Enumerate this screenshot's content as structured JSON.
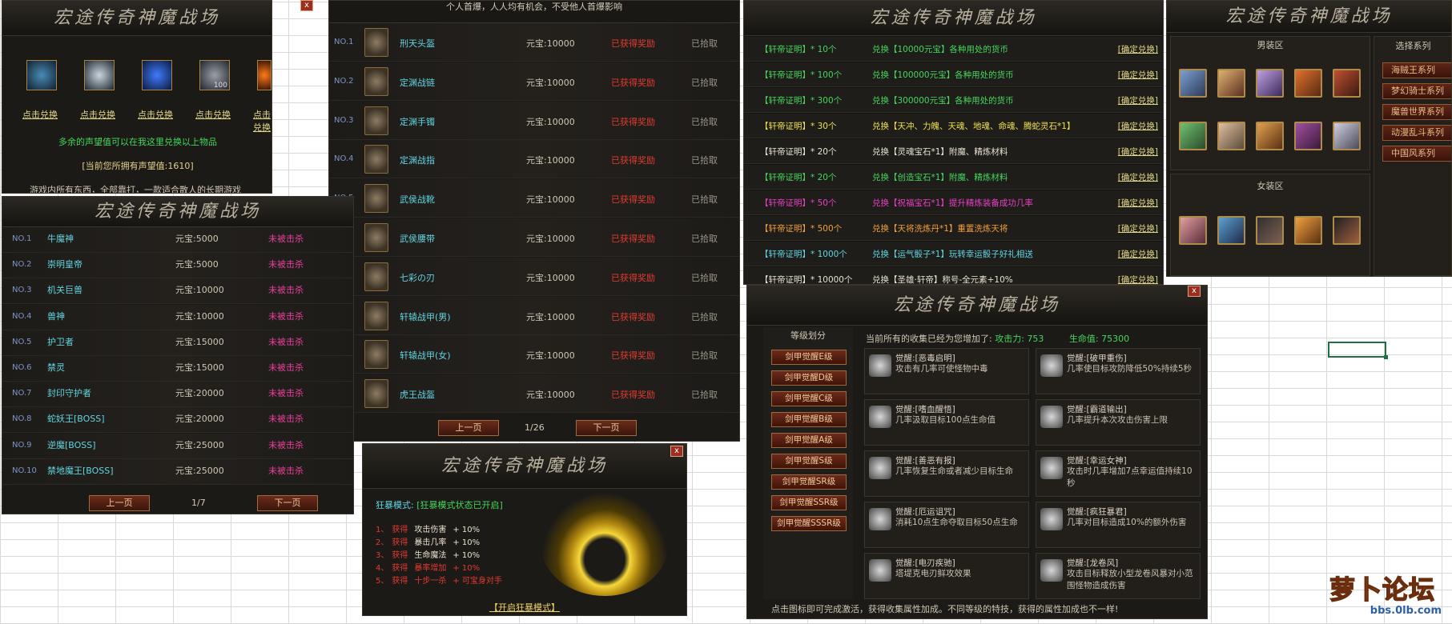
{
  "panel_exchange": {
    "title": "宏途传奇神魔战场",
    "items": [
      "点击兑换",
      "点击兑换",
      "点击兑换",
      "点击兑换",
      "点击兑换"
    ],
    "slot4_count": "100",
    "hint": "多余的声望值可以在我这里兑换以上物品",
    "current": "[当前您所拥有声望值:1610]",
    "footer": "游戏内所有东西，全部靠打，一款适合散人的长期游戏"
  },
  "panel_drops": {
    "header": "个人首爆，人人均有机会，不受他人首爆影响",
    "rows": [
      {
        "no": "NO.1",
        "name": "刑天头盔",
        "reward": "元宝:10000",
        "status": "已获得奖励",
        "action": "已拾取"
      },
      {
        "no": "NO.2",
        "name": "定渊战链",
        "reward": "元宝:10000",
        "status": "已获得奖励",
        "action": "已拾取"
      },
      {
        "no": "NO.3",
        "name": "定渊手镯",
        "reward": "元宝:10000",
        "status": "已获得奖励",
        "action": "已拾取"
      },
      {
        "no": "NO.4",
        "name": "定渊战指",
        "reward": "元宝:10000",
        "status": "已获得奖励",
        "action": "已拾取"
      },
      {
        "no": "NO.5",
        "name": "武侯战靴",
        "reward": "元宝:10000",
        "status": "已获得奖励",
        "action": "已拾取"
      },
      {
        "no": "",
        "name": "武侯腰带",
        "reward": "元宝:10000",
        "status": "已获得奖励",
        "action": "已拾取"
      },
      {
        "no": "",
        "name": "七彩の刃",
        "reward": "元宝:10000",
        "status": "已获得奖励",
        "action": "已拾取"
      },
      {
        "no": "",
        "name": "轩辕战甲(男)",
        "reward": "元宝:10000",
        "status": "已获得奖励",
        "action": "已拾取"
      },
      {
        "no": "",
        "name": "轩辕战甲(女)",
        "reward": "元宝:10000",
        "status": "已获得奖励",
        "action": "已拾取"
      },
      {
        "no": "",
        "name": "虎王战盔",
        "reward": "元宝:10000",
        "status": "已获得奖励",
        "action": "已拾取"
      }
    ],
    "prev": "上一页",
    "page": "1/26",
    "next": "下一页"
  },
  "panel_boss": {
    "title": "宏途传奇神魔战场",
    "rows": [
      {
        "no": "NO.1",
        "name": "牛魔神",
        "reward": "元宝:5000",
        "status": "未被击杀"
      },
      {
        "no": "NO.2",
        "name": "崇明皇帝",
        "reward": "元宝:5000",
        "status": "未被击杀"
      },
      {
        "no": "NO.3",
        "name": "机关巨兽",
        "reward": "元宝:10000",
        "status": "未被击杀"
      },
      {
        "no": "NO.4",
        "name": "兽神",
        "reward": "元宝:10000",
        "status": "未被击杀"
      },
      {
        "no": "NO.5",
        "name": "护卫者",
        "reward": "元宝:15000",
        "status": "未被击杀"
      },
      {
        "no": "NO.6",
        "name": "禁灵",
        "reward": "元宝:15000",
        "status": "未被击杀"
      },
      {
        "no": "NO.7",
        "name": "封印守护者",
        "reward": "元宝:20000",
        "status": "未被击杀"
      },
      {
        "no": "NO.8",
        "name": "蛇妖王[BOSS]",
        "reward": "元宝:20000",
        "status": "未被击杀"
      },
      {
        "no": "NO.9",
        "name": "逆魔[BOSS]",
        "reward": "元宝:25000",
        "status": "未被击杀"
      },
      {
        "no": "NO.10",
        "name": "禁地魔王[BOSS]",
        "reward": "元宝:25000",
        "status": "未被击杀"
      }
    ],
    "prev": "上一页",
    "page": "1/7",
    "next": "下一页"
  },
  "panel_frenzy": {
    "title": "宏途传奇神魔战场",
    "mode_label": "狂暴模式:",
    "mode_status": "[狂暴模式状态已开启]",
    "lines": [
      {
        "idx": "1、",
        "get": "获得",
        "what": "攻击伤害",
        "val": "+ 10%"
      },
      {
        "idx": "2、",
        "get": "获得",
        "what": "暴击几率",
        "val": "+ 10%"
      },
      {
        "idx": "3、",
        "get": "获得",
        "what": "生命魔法",
        "val": "+ 10%"
      },
      {
        "idx": "4、",
        "get": "获得",
        "what": "暴率增加",
        "val": "+ 10%"
      },
      {
        "idx": "5、",
        "get": "获得",
        "what": "十步一杀",
        "val": "+ 可宝身对手"
      }
    ],
    "button": "【开启狂暴模式】"
  },
  "panel_cert": {
    "title": "宏途传奇神魔战场",
    "rows": [
      {
        "c": "green",
        "req": "【轩帝证明】* 10个",
        "desc": "兑换【10000元宝】各种用处的货币",
        "btn": "[确定兑换]"
      },
      {
        "c": "green",
        "req": "【轩帝证明】* 100个",
        "desc": "兑换【100000元宝】各种用处的货币",
        "btn": "[确定兑换]"
      },
      {
        "c": "green",
        "req": "【轩帝证明】* 300个",
        "desc": "兑换【300000元宝】各种用处的货币",
        "btn": "[确定兑换]"
      },
      {
        "c": "yellow",
        "req": "【轩帝证明】* 30个",
        "desc": "兑换【天冲、力魄、天魂、地魂、命魂、腾蛇灵石*1】",
        "btn": "[确定兑换]"
      },
      {
        "c": "white",
        "req": "【轩帝证明】* 20个",
        "desc": "兑换【灵魂宝石*1】附魔、精炼材料",
        "btn": "[确定兑换]"
      },
      {
        "c": "green",
        "req": "【轩帝证明】* 20个",
        "desc": "兑换【创造宝石*1】附魔、精炼材料",
        "btn": "[确定兑换]"
      },
      {
        "c": "pink",
        "req": "【轩帝证明】* 50个",
        "desc": "兑换【祝福宝石*1】提升精炼装备成功几率",
        "btn": "[确定兑换]"
      },
      {
        "c": "orange",
        "req": "【轩帝证明】* 500个",
        "desc": "兑换【天将洗炼丹*1】重置洗炼天将",
        "btn": "[确定兑换]"
      },
      {
        "c": "cyan",
        "req": "【轩帝证明】* 1000个",
        "desc": "兑换【运气骰子*1】玩转幸运骰子好礼相送",
        "btn": "[确定兑换]"
      },
      {
        "c": "white",
        "req": "【轩帝证明】* 10000个",
        "desc": "兑换【圣雄·轩帝】称号-全元素+10%",
        "btn": "[确定兑换]"
      }
    ]
  },
  "panel_fashion": {
    "title": "宏途传奇神魔战场",
    "male": "男装区",
    "female": "女装区",
    "series_label": "选择系列",
    "series": [
      "海贼王系列",
      "梦幻骑士系列",
      "魔兽世界系列",
      "动漫乱斗系列",
      "中国风系列"
    ]
  },
  "panel_awaken": {
    "title": "宏途传奇神魔战场",
    "grade_label": "等级划分",
    "summary_prefix": "当前所有的收集已经为您增加了:",
    "atk_label": "攻击力:",
    "atk": "753",
    "hp_label": "生命值:",
    "hp": "75300",
    "grades": [
      "剑甲觉醒E级",
      "剑甲觉醒D级",
      "剑甲觉醒C级",
      "剑甲觉醒B级",
      "剑甲觉醒A级",
      "剑甲觉醒S级",
      "剑甲觉醒SR级",
      "剑甲觉醒SSR级",
      "剑甲觉醒SSSR级"
    ],
    "skills": [
      {
        "t": "觉醒:[恶毒启明]",
        "d": "攻击有几率可使怪物中毒"
      },
      {
        "t": "觉醒:[破甲重伤]",
        "d": "几率使目标攻防降低50%持续5秒"
      },
      {
        "t": "觉醒:[嗜血醒悟]",
        "d": "几率汲取目标100点生命值"
      },
      {
        "t": "觉醒:[霸道输出]",
        "d": "几率提升本次攻击伤害上限"
      },
      {
        "t": "觉醒:[善恶有报]",
        "d": "几率恢复生命或者减少目标生命"
      },
      {
        "t": "觉醒:[幸运女神]",
        "d": "攻击时几率增加7点幸运值持续10秒"
      },
      {
        "t": "觉醒:[厄运诅咒]",
        "d": "消耗10点生命夺取目标50点生命"
      },
      {
        "t": "觉醒:[疯狂暴君]",
        "d": "几率对目标造成10%的额外伤害"
      },
      {
        "t": "觉醒:[电刃疾驰]",
        "d": "塔堤克电刃鲜攻效果"
      },
      {
        "t": "觉醒:[龙卷风]",
        "d": "攻击目标释放小型龙卷风暴对小范围怪物造成伤害"
      }
    ],
    "footer": "点击图标即可完成激活，获得收集属性加成。不同等级的特技，获得的属性加成也不一样!"
  },
  "watermark": {
    "name": "萝卜论坛",
    "url": "bbs.0lb.com"
  },
  "close_glyph": "x"
}
